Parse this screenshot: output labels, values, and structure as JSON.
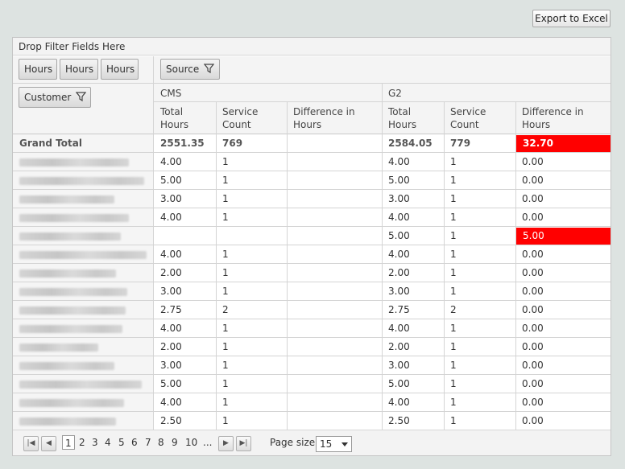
{
  "export_label": "Export to Excel",
  "drop_filter_label": "Drop Filter Fields Here",
  "data_fields": [
    "Hours",
    "Hours",
    "Hours"
  ],
  "column_field": "Source",
  "row_field": "Customer",
  "groups": [
    "CMS",
    "G2"
  ],
  "col_headers": [
    "Total Hours",
    "Service Count",
    "Difference in Hours"
  ],
  "col_header_lines": [
    [
      "Total",
      "Hours"
    ],
    [
      "Service",
      "Count"
    ],
    [
      "Difference in",
      "Hours"
    ]
  ],
  "grand_total": {
    "label": "Grand Total",
    "cms": [
      "2551.35",
      "769",
      ""
    ],
    "g2": [
      "2584.05",
      "779",
      "32.70"
    ]
  },
  "rows": [
    {
      "cms": [
        "4.00",
        "1",
        ""
      ],
      "g2": [
        "4.00",
        "1",
        "0.00"
      ]
    },
    {
      "cms": [
        "5.00",
        "1",
        ""
      ],
      "g2": [
        "5.00",
        "1",
        "0.00"
      ]
    },
    {
      "cms": [
        "3.00",
        "1",
        ""
      ],
      "g2": [
        "3.00",
        "1",
        "0.00"
      ]
    },
    {
      "cms": [
        "4.00",
        "1",
        ""
      ],
      "g2": [
        "4.00",
        "1",
        "0.00"
      ]
    },
    {
      "cms": [
        "",
        "",
        ""
      ],
      "g2": [
        "5.00",
        "1",
        "5.00"
      ]
    },
    {
      "cms": [
        "4.00",
        "1",
        ""
      ],
      "g2": [
        "4.00",
        "1",
        "0.00"
      ]
    },
    {
      "cms": [
        "2.00",
        "1",
        ""
      ],
      "g2": [
        "2.00",
        "1",
        "0.00"
      ]
    },
    {
      "cms": [
        "3.00",
        "1",
        ""
      ],
      "g2": [
        "3.00",
        "1",
        "0.00"
      ]
    },
    {
      "cms": [
        "2.75",
        "2",
        ""
      ],
      "g2": [
        "2.75",
        "2",
        "0.00"
      ]
    },
    {
      "cms": [
        "4.00",
        "1",
        ""
      ],
      "g2": [
        "4.00",
        "1",
        "0.00"
      ]
    },
    {
      "cms": [
        "2.00",
        "1",
        ""
      ],
      "g2": [
        "2.00",
        "1",
        "0.00"
      ]
    },
    {
      "cms": [
        "3.00",
        "1",
        ""
      ],
      "g2": [
        "3.00",
        "1",
        "0.00"
      ]
    },
    {
      "cms": [
        "5.00",
        "1",
        ""
      ],
      "g2": [
        "5.00",
        "1",
        "0.00"
      ]
    },
    {
      "cms": [
        "4.00",
        "1",
        ""
      ],
      "g2": [
        "4.00",
        "1",
        "0.00"
      ]
    },
    {
      "cms": [
        "2.50",
        "1",
        ""
      ],
      "g2": [
        "2.50",
        "1",
        "0.00"
      ]
    }
  ],
  "highlight_color": "#ff0000",
  "pager": {
    "current": "1",
    "pages": [
      "2",
      "3",
      "4",
      "5",
      "6",
      "7",
      "8",
      "9",
      "10",
      "..."
    ],
    "page_size_label": "Page size:",
    "page_size": "15"
  }
}
